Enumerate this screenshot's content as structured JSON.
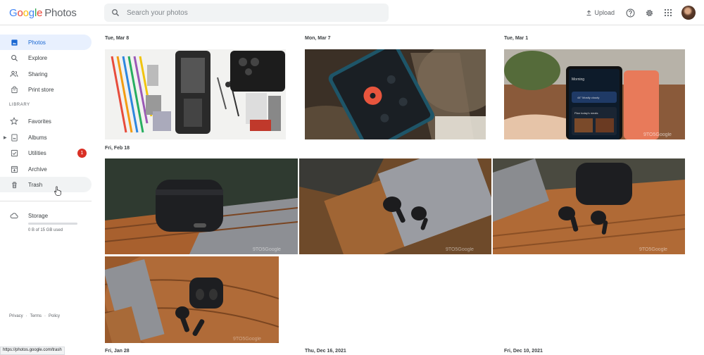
{
  "header": {
    "logo_google": [
      "G",
      "o",
      "o",
      "g",
      "l",
      "e"
    ],
    "logo_product": "Photos",
    "search_placeholder": "Search your photos",
    "upload_label": "Upload"
  },
  "sidebar": {
    "items": [
      {
        "label": "Photos",
        "icon": "photo-icon"
      },
      {
        "label": "Explore",
        "icon": "search-icon"
      },
      {
        "label": "Sharing",
        "icon": "people-icon"
      },
      {
        "label": "Print store",
        "icon": "bag-icon"
      }
    ],
    "library_heading": "LIBRARY",
    "library_items": [
      {
        "label": "Favorites",
        "icon": "star-icon"
      },
      {
        "label": "Albums",
        "icon": "album-icon"
      },
      {
        "label": "Utilities",
        "icon": "checkbox-icon",
        "badge": "1"
      },
      {
        "label": "Archive",
        "icon": "archive-icon"
      },
      {
        "label": "Trash",
        "icon": "trash-icon"
      }
    ],
    "storage_label": "Storage",
    "storage_used": "0 B of 15 GB used",
    "footer": [
      "Privacy",
      "·",
      "Terms",
      "·",
      "Policy"
    ]
  },
  "status_url": "https://photos.google.com/trash",
  "groups": [
    {
      "date": "Tue, Mar 8"
    },
    {
      "date": "Mon, Mar 7"
    },
    {
      "date": "Tue, Mar 1"
    },
    {
      "date": "Fri, Feb 18"
    },
    {
      "date": "Fri, Jan 28"
    },
    {
      "date": "Thu, Dec 16, 2021"
    },
    {
      "date": "Fri, Dec 10, 2021"
    }
  ],
  "photo_text": {
    "phone_app_title": "Morning",
    "weather_card": "44° Mostly cloudy",
    "recipe_card": "Plan today's meals",
    "watermark": "9TO5Google"
  },
  "colors": {
    "accent": "#1967d2",
    "active_bg": "#e8f0fe",
    "badge": "#d93025"
  }
}
